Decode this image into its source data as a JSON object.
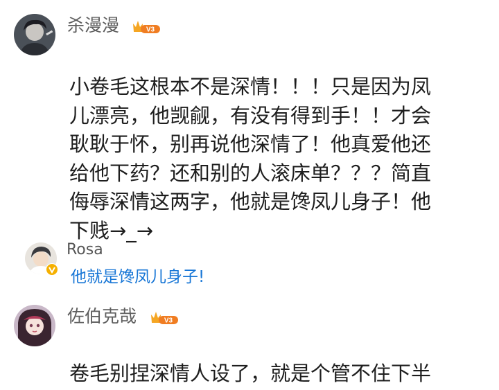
{
  "comments": [
    {
      "username": "杀漫漫",
      "level_badge": "crown-icon v3",
      "text_lines": [
        "小卷毛这根本不是深情！！！只是因为凤",
        "儿漂亮，他觊觎，有没有得到手！！才会",
        "耿耿于怀，别再说他深情了！他真爱他还",
        "给他下药？还和别的人滚床单？？？简直",
        "侮辱深情这两字，他就是馋凤儿身子！他",
        "下贱→_→"
      ],
      "reply": {
        "username": "Rosa",
        "badge": "verified-v-icon",
        "text": "他就是馋凤儿身子!"
      }
    },
    {
      "username": "佐伯克哉",
      "level_badge": "crown-icon v3",
      "text_lines": [
        "卷毛别捏深情人设了，就是个管不住下半"
      ]
    }
  ],
  "colors": {
    "username": "#5e5e5e",
    "reply_link": "#1776d6",
    "badge_gold": "#f5a623",
    "badge_orange": "#f07d22"
  }
}
